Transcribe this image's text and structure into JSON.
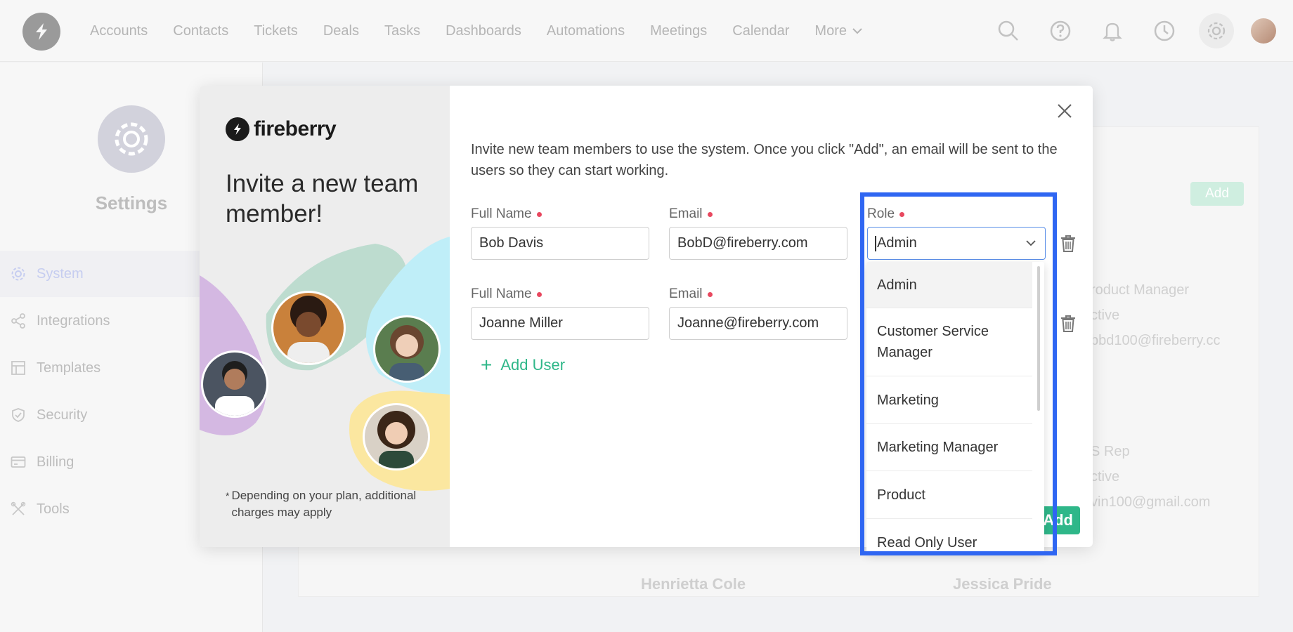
{
  "topnav": {
    "items": [
      "Accounts",
      "Contacts",
      "Tickets",
      "Deals",
      "Tasks",
      "Dashboards",
      "Automations",
      "Meetings",
      "Calendar"
    ],
    "more_label": "More"
  },
  "sidebar": {
    "title": "Settings",
    "items": [
      {
        "label": "System",
        "icon": "gear-icon",
        "active": true
      },
      {
        "label": "Integrations",
        "icon": "share-icon",
        "active": false
      },
      {
        "label": "Templates",
        "icon": "template-icon",
        "active": false
      },
      {
        "label": "Security",
        "icon": "shield-icon",
        "active": false
      },
      {
        "label": "Billing",
        "icon": "card-icon",
        "active": false
      },
      {
        "label": "Tools",
        "icon": "tools-icon",
        "active": false
      }
    ]
  },
  "background": {
    "add_label": "Add",
    "card1": {
      "role": "roduct Manager",
      "status": "ctive",
      "email": "bbd100@fireberry.cc"
    },
    "card2": {
      "role": "S Rep",
      "status": "ctive",
      "email": "vin100@gmail.com"
    },
    "names": [
      "Henrietta Cole",
      "Jessica Pride"
    ]
  },
  "modal": {
    "brand": "fireberry",
    "headline": "Invite a new team member!",
    "footnote": "Depending on your plan, additional charges may apply",
    "intro": "Invite new team members to use the system. Once you click \"Add\", an email will be sent to the users so they can start working.",
    "labels": {
      "full_name": "Full Name",
      "email": "Email",
      "role": "Role"
    },
    "rows": [
      {
        "full_name": "Bob Davis",
        "email": "BobD@fireberry.com",
        "role": "Admin"
      },
      {
        "full_name": "Joanne Miller",
        "email": "Joanne@fireberry.com"
      }
    ],
    "add_user_label": "Add User",
    "submit_label": "Add",
    "role_options": [
      "Admin",
      "Customer Service Manager",
      "Marketing",
      "Marketing Manager",
      "Product",
      "Read Only User"
    ],
    "selected_role": "Admin"
  },
  "colors": {
    "accent_green": "#2fb789",
    "highlight_blue": "#2f66f2",
    "required_dot": "#e8485f"
  }
}
